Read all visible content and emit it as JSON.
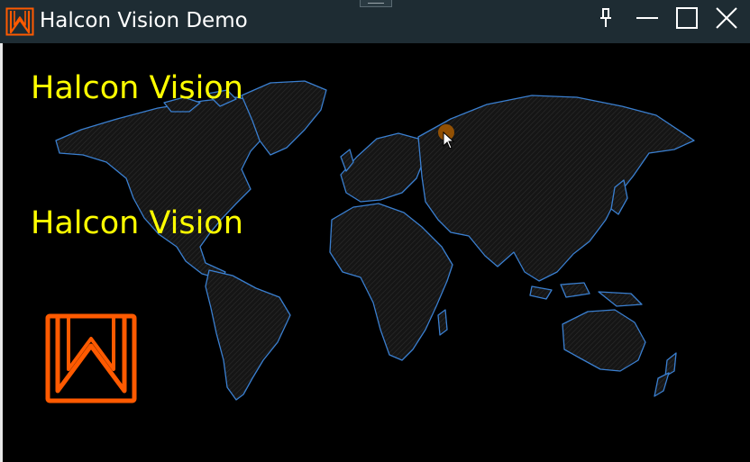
{
  "window": {
    "title": "Halcon Vision Demo",
    "icons": {
      "app": "halcon-logo-icon",
      "pin": "pin-icon",
      "minimize": "minimize-icon",
      "maximize": "maximize-icon",
      "close": "close-icon"
    }
  },
  "overlay": {
    "text_1": "Halcon Vision",
    "text_2": "Halcon Vision"
  },
  "colors": {
    "titlebar": "#1e2c33",
    "background": "#000000",
    "overlay_text": "#ffff00",
    "logo": "#ff5a00",
    "map_outline": "#3a7fd0",
    "map_fill": "#1c1c1c",
    "marker": "#a85a00"
  }
}
